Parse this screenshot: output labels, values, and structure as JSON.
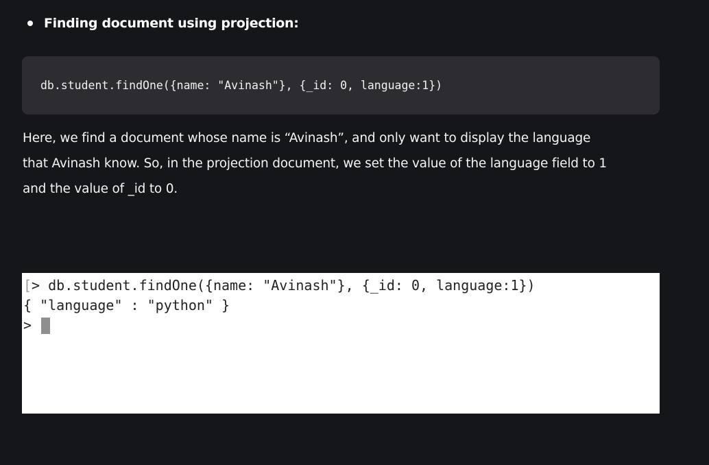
{
  "section": {
    "heading": "Finding document using projection:"
  },
  "code_block": {
    "code": "db.student.findOne({name: \"Avinash\"}, {_id: 0, language:1})"
  },
  "paragraph": {
    "line1": "Here, we find a document whose name is “Avinash”, and only want to display the language",
    "line2": "that Avinash know. So, in the projection document, we set the value of the language field to 1",
    "line3": "and the value of _id to 0."
  },
  "terminal": {
    "lines": [
      {
        "bracket": "[",
        "prompt": "> ",
        "text": "db.student.findOne({name: \"Avinash\"}, {_id: 0, language:1})"
      },
      {
        "bracket": "",
        "prompt": "",
        "text": "{ \"language\" : \"python\" }"
      },
      {
        "bracket": "",
        "prompt": "> ",
        "text": ""
      }
    ]
  }
}
